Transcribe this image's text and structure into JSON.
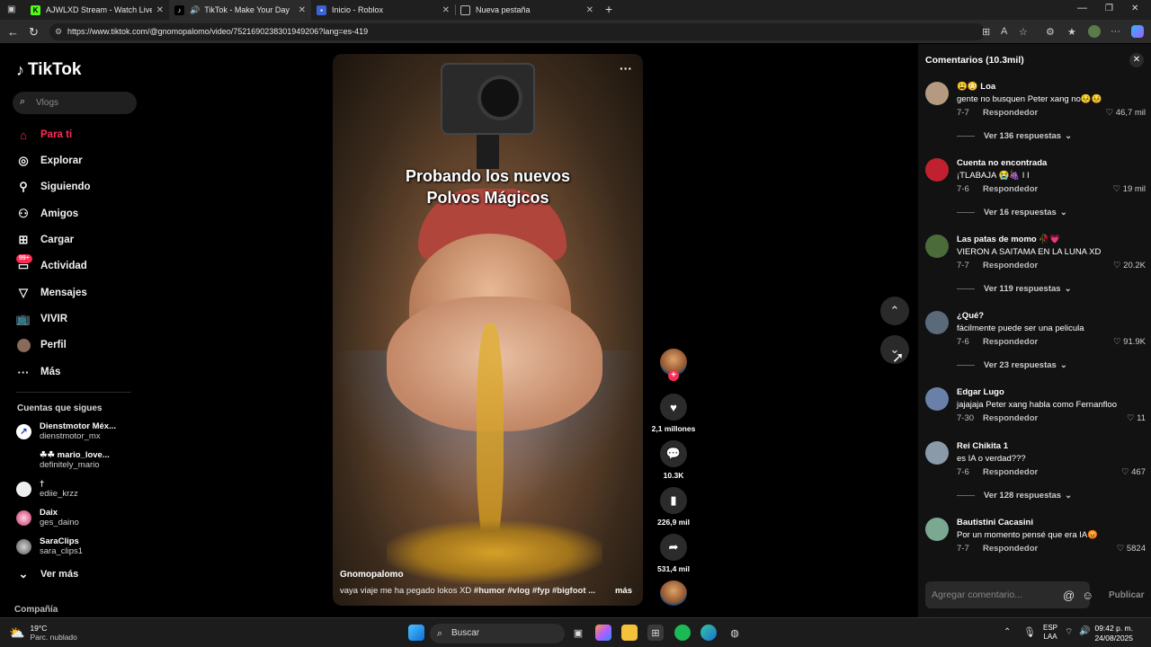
{
  "browser": {
    "tabs": [
      {
        "title": "AJWLXD Stream - Watch Live on",
        "active": false
      },
      {
        "title": "TikTok - Make Your Day",
        "active": true
      },
      {
        "title": "Inicio - Roblox",
        "active": false
      },
      {
        "title": "Nueva pestaña",
        "active": false
      }
    ],
    "url": "https://www.tiktok.com/@gnomopalomo/video/7521690238301949206?lang=es-419"
  },
  "sidebar": {
    "logo": "TikTok",
    "search_placeholder": "Vlogs",
    "nav": [
      {
        "label": "Para ti",
        "icon": "home-icon"
      },
      {
        "label": "Explorar",
        "icon": "compass-icon"
      },
      {
        "label": "Siguiendo",
        "icon": "following-icon"
      },
      {
        "label": "Amigos",
        "icon": "friends-icon"
      },
      {
        "label": "Cargar",
        "icon": "upload-icon"
      },
      {
        "label": "Actividad",
        "icon": "activity-icon",
        "badge": "99+"
      },
      {
        "label": "Mensajes",
        "icon": "messages-icon"
      },
      {
        "label": "VIVIR",
        "icon": "live-icon"
      },
      {
        "label": "Perfil",
        "icon": "profile-icon"
      },
      {
        "label": "Más",
        "icon": "more-icon"
      }
    ],
    "following_title": "Cuentas que sigues",
    "following": [
      {
        "name": "Dienstmotor Méx...",
        "handle": "dienstmotor_mx"
      },
      {
        "name": "☘☘ mario_love...",
        "handle": "definitely_mario"
      },
      {
        "name": "†",
        "handle": "ediie_krzz"
      },
      {
        "name": "Daix",
        "handle": "ges_daino"
      },
      {
        "name": "SaraClips",
        "handle": "sara_clips1"
      }
    ],
    "see_more": "Ver más",
    "company": "Compañía"
  },
  "video": {
    "title_line1": "Probando los nuevos",
    "title_line2": "Polvos Mágicos",
    "author": "Gnomopalomo",
    "caption_text": "vaya viaje me ha pegado lokos XD",
    "hashtags": "#humor  #vlog  #fyp  #bigfoot  ...",
    "more": "más",
    "more_dots": "···"
  },
  "actions": {
    "likes": "2,1 millones",
    "comments": "10.3K",
    "saves": "226,9 mil",
    "shares": "531,4 mil"
  },
  "comments": {
    "header": "Comentarios (10.3mil)",
    "input_placeholder": "Agregar comentario...",
    "publish": "Publicar",
    "reply_label": "Respondedor",
    "items": [
      {
        "user": "😩😳 Loa",
        "text": "gente no busquen Peter xang no😣😣",
        "date": "7-7",
        "likes": "46,7 mil",
        "more": "Ver 136 respuestas",
        "color": "#b49a80"
      },
      {
        "user": "Cuenta no encontrada",
        "text": "¡TLABAJA 😭🍇 I I",
        "date": "7-6",
        "likes": "19 mil",
        "more": "Ver 16 respuestas",
        "color": "#c02030"
      },
      {
        "user": "Las patas de momo 🥀💗",
        "text": "VIERON A SAITAMA EN LA LUNA XD",
        "date": "7-7",
        "likes": "20.2K",
        "more": "Ver 119 respuestas",
        "color": "#4b6b3a"
      },
      {
        "user": "¿Qué?",
        "text": "fácilmente puede ser una pelicula",
        "date": "7-6",
        "likes": "91.9K",
        "more": "Ver 23 respuestas",
        "color": "#5a6a7a"
      },
      {
        "user": "Edgar Lugo",
        "text": "jajajaja Peter xang habla como Fernanfloo",
        "date": "7-30",
        "likes": "11",
        "more": "",
        "color": "#6a80a8"
      },
      {
        "user": "Rei Chikita 1",
        "text": "es IA o verdad???",
        "date": "7-6",
        "likes": "467",
        "more": "Ver 128 respuestas",
        "color": "#8a9aa8"
      },
      {
        "user": "Bautistini Cacasini",
        "text": "Por un momento pensé que era IA😡",
        "date": "7-7",
        "likes": "5824",
        "more": "",
        "color": "#7aa890"
      }
    ]
  },
  "taskbar": {
    "temp": "19°C",
    "weather": "Parc. nublado",
    "search": "Buscar",
    "lang1": "ESP",
    "lang2": "LAA",
    "time": "09:42 p. m.",
    "date": "24/08/2025"
  }
}
